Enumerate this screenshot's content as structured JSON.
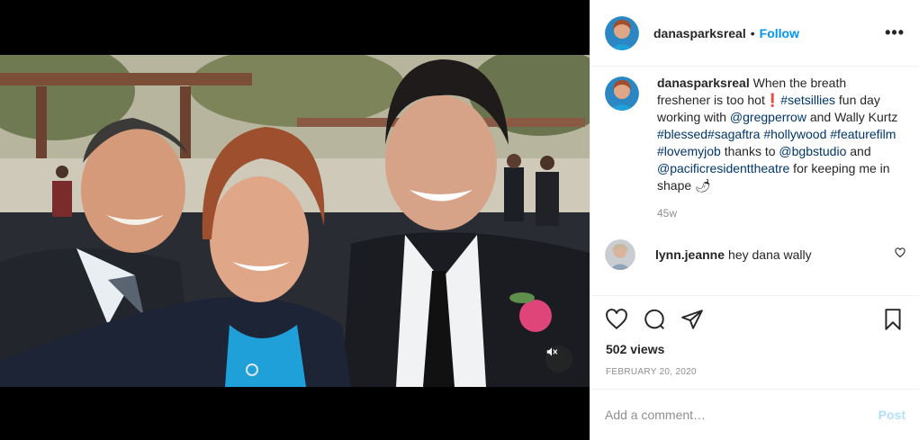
{
  "post": {
    "username": "danasparksreal",
    "follow_label": "Follow",
    "separator": "•",
    "more_label": "•••"
  },
  "caption": {
    "username": "danasparksreal",
    "text_1": "When the breath freshener is too hot",
    "emoji_1": "❗",
    "tag_setsillies": "#setsillies",
    "text_2": " fun day working with ",
    "mention_gregperrow": "@gregperrow",
    "text_3": " and Wally Kurtz ",
    "tag_blessed": "#blessed",
    "tag_sagaftra": "#sagaftra",
    "tag_hollywood": "#hollywood",
    "tag_featurefilm": "#featurefilm",
    "tag_lovemyjob": "#lovemyjob",
    "text_4": " thanks to ",
    "mention_bgbstudio": "@bgbstudio",
    "text_5": " and ",
    "mention_pacific": "@pacificresidenttheatre",
    "text_6": " for keeping me in shape ",
    "emoji_2": "🌶",
    "time": "45w"
  },
  "comments": [
    {
      "username": "lynn.jeanne",
      "text": "hey dana wally"
    }
  ],
  "stats": {
    "views": "502 views",
    "date": "FEBRUARY 20, 2020"
  },
  "add_comment": {
    "placeholder": "Add a comment…",
    "post_label": "Post"
  },
  "icons": {
    "like": "heart-icon",
    "comment": "comment-icon",
    "share": "share-icon",
    "save": "bookmark-icon",
    "mute": "mute-icon",
    "more": "more-icon"
  },
  "colors": {
    "accent": "#0095f6",
    "link": "#00376b",
    "muted": "#8e8e8e",
    "post_disabled": "#b2dffc"
  }
}
